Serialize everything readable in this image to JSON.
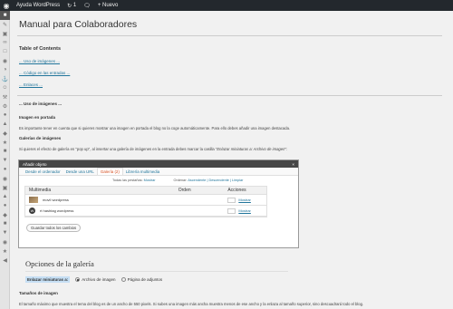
{
  "adminbar": {
    "site": "Ayuda WordPress",
    "updates": "1",
    "new_label": "Nuevo"
  },
  "page": {
    "title": "Manual para Colaboradores"
  },
  "toc": {
    "title": "Table of Contents",
    "links": [
      "... Uso de imágenes ...",
      "... Código en las entradas ...",
      "... Enlaces ..."
    ]
  },
  "content": {
    "section_title": "... Uso de imágenes ...",
    "featured_title": "Imagen en portada",
    "featured_text": "Es importante tener en cuenta que si quieres mostrar una imagen en portada el blog no la coge automáticamente. Para ello debes añadir una imagen destacada.",
    "gallery_title": "Galerías de imágenes",
    "gallery_text_a": "Si quieres el efecto de galería en \"pop up\", al insertar una galería de imágenes en la entrada debes marcar la casilla \"",
    "gallery_text_italic": "Enlazar miniaturas a: Archivo de imagen",
    "gallery_text_b": "\":",
    "size_title": "Tamaños de imagen",
    "size_text": "El tamaño máximo que muestra el tema del blog es de un ancho de 550 pixels. Si subes una imagen más ancha muestra menos de ese ancho y la enlaza al tamaño superior, sino descuadrará todo el blog."
  },
  "modal": {
    "title": "Añadir objeto",
    "close": "×",
    "tabs": [
      "Desde el ordenador",
      "Desde una URL",
      "Galería (2)",
      "Librería multimedia"
    ],
    "filter_label": "Todas las pestañas:",
    "filter_show": "Mostrar",
    "order_label": "Ordenar:",
    "order_options": "Ascendente | Descendente | Limpiar",
    "col_media": "Multimedia",
    "col_order": "Orden",
    "col_actions": "Acciones",
    "rows": [
      {
        "name": "movil wordpress",
        "action": "Mostrar"
      },
      {
        "name": "rt hashtag wordpress",
        "action": "Mostrar"
      }
    ],
    "save_button": "Guardar todos los cambios",
    "gallery_options_title": "Opciones de la galería",
    "link_thumbs_label": "Enlazar miniaturas a:",
    "option_file": "Archivo de imagen",
    "option_attachment": "Página de adjuntos"
  }
}
